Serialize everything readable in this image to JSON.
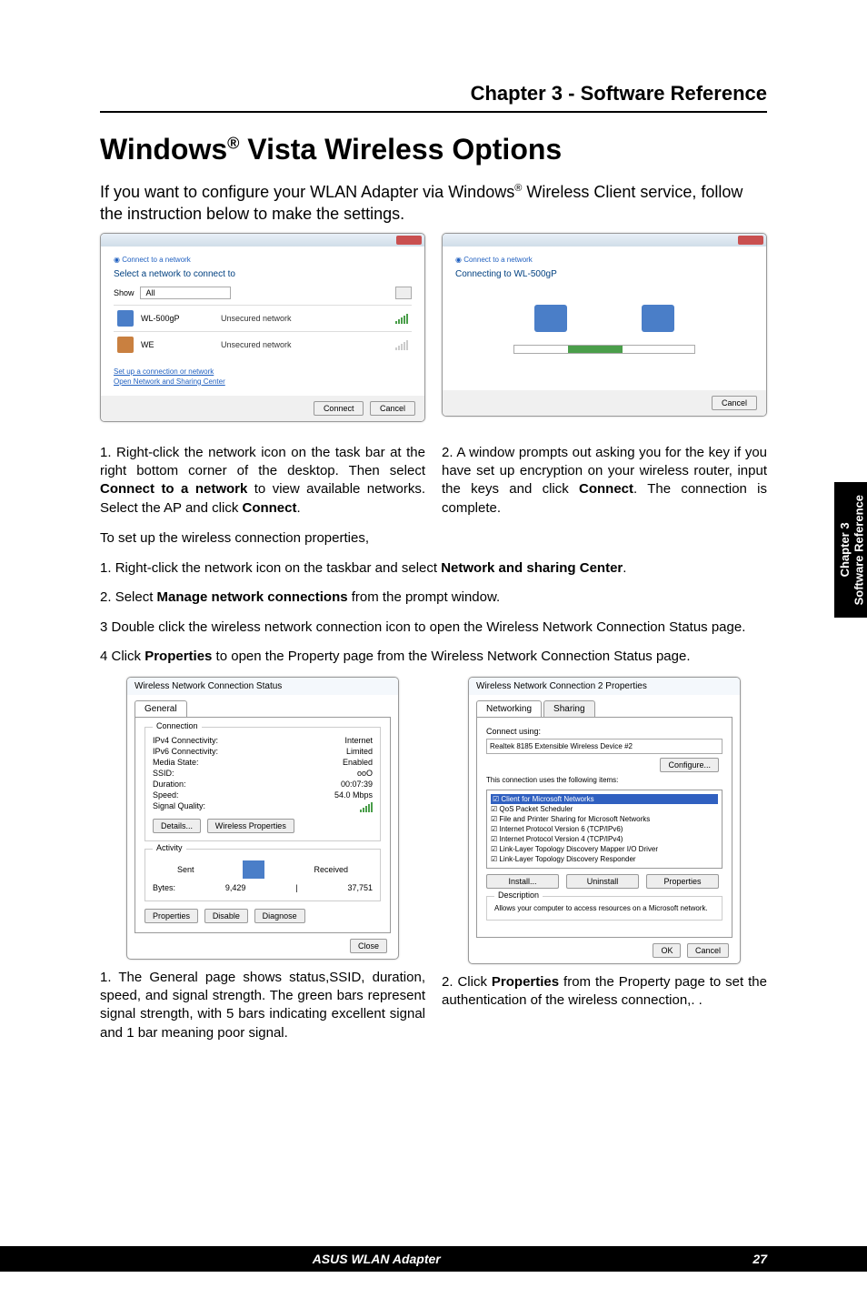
{
  "chapter_header": "Chapter 3 - Software Reference",
  "title_part1": "Windows",
  "title_sup": "®",
  "title_part2": " Vista Wireless Options",
  "intro_part1": "If you want to configure your WLAN Adapter via Windows",
  "intro_sup": "®",
  "intro_part2": " Wireless Client service, follow the instruction below to make the settings.",
  "dialog1": {
    "breadcrumb": "Connect to a network",
    "heading": "Select a network to connect to",
    "show_label": "Show",
    "show_value": "All",
    "net1_name": "WL-500gP",
    "net1_type": "Unsecured network",
    "net2_name": "WE",
    "net2_type": "Unsecured network",
    "link1": "Set up a connection or network",
    "link2": "Open Network and Sharing Center",
    "connect_btn": "Connect",
    "cancel_btn": "Cancel"
  },
  "dialog2": {
    "breadcrumb": "Connect to a network",
    "heading": "Connecting to WL-500gP",
    "cancel_btn": "Cancel"
  },
  "caption1_num": "1. ",
  "caption1_text_a": "Right-click the network icon on the task bar at the right bottom corner of the desktop. Then select ",
  "caption1_bold": "Connect to a network",
  "caption1_text_b": " to view available networks. Select the AP and click ",
  "caption1_bold2": "Connect",
  "caption1_text_c": ".",
  "caption2_num": "2. ",
  "caption2_text_a": "A window prompts out asking you for the key if you have set up encryption on your wireless router, input the keys and click ",
  "caption2_bold": "Connect",
  "caption2_text_b": ". The connection is complete.",
  "setup_intro": "To set up the wireless connection properties,",
  "list1_num": "1. ",
  "list1_a": "Right-click the network icon on the taskbar and select ",
  "list1_bold": "Network and sharing Center",
  "list1_b": ".",
  "list2_num": "2. ",
  "list2_a": "Select ",
  "list2_bold": "Manage network connections",
  "list2_b": " from the prompt window.",
  "list3_num": "3  ",
  "list3_a": "Double click the wireless network connection icon to open the Wireless Network Connection Status page.",
  "list4_num": "4 ",
  "list4_a": "Click ",
  "list4_bold": "Properties",
  "list4_b": " to open the Property page from the Wireless Network Connection Status page.",
  "status_dialog": {
    "title": "Wireless Network Connection Status",
    "tab": "General",
    "fs1": "Connection",
    "ipv4_label": "IPv4 Connectivity:",
    "ipv4_value": "Internet",
    "ipv6_label": "IPv6 Connectivity:",
    "ipv6_value": "Limited",
    "media_label": "Media State:",
    "media_value": "Enabled",
    "ssid_label": "SSID:",
    "ssid_value": "ooO",
    "dur_label": "Duration:",
    "dur_value": "00:07:39",
    "speed_label": "Speed:",
    "speed_value": "54.0 Mbps",
    "sq_label": "Signal Quality:",
    "details_btn": "Details...",
    "wprops_btn": "Wireless Properties",
    "fs2": "Activity",
    "sent": "Sent",
    "received": "Received",
    "bytes_label": "Bytes:",
    "bytes_sent": "9,429",
    "bytes_recv": "37,751",
    "props_btn": "Properties",
    "disable_btn": "Disable",
    "diag_btn": "Diagnose",
    "close_btn": "Close"
  },
  "props_dialog": {
    "title": "Wireless Network Connection 2 Properties",
    "tab1": "Networking",
    "tab2": "Sharing",
    "connect_using": "Connect using:",
    "adapter": "Realtek 8185 Extensible Wireless Device #2",
    "configure_btn": "Configure...",
    "items_label": "This connection uses the following items:",
    "item1": "Client for Microsoft Networks",
    "item2": "QoS Packet Scheduler",
    "item3": "File and Printer Sharing for Microsoft Networks",
    "item4": "Internet Protocol Version 6 (TCP/IPv6)",
    "item5": "Internet Protocol Version 4 (TCP/IPv4)",
    "item6": "Link-Layer Topology Discovery Mapper I/O Driver",
    "item7": "Link-Layer Topology Discovery Responder",
    "install_btn": "Install...",
    "uninstall_btn": "Uninstall",
    "props_btn": "Properties",
    "desc_label": "Description",
    "desc_text": "Allows your computer to access resources on a Microsoft network.",
    "ok_btn": "OK",
    "cancel_btn": "Cancel"
  },
  "caption3_num": "1. ",
  "caption3_text": "The General page shows status,SSID, duration, speed, and signal strength. The green bars represent signal strength, with 5 bars indicating excellent signal and 1 bar meaning poor signal.",
  "caption4_num": "2. ",
  "caption4_a": "Click ",
  "caption4_bold": "Properties",
  "caption4_b": " from the Property page to set the authentication of the wireless connection,.  .",
  "side_tab_line1": "Chapter 3",
  "side_tab_line2": "Software Reference",
  "footer_title": "ASUS WLAN Adapter",
  "footer_page": "27"
}
